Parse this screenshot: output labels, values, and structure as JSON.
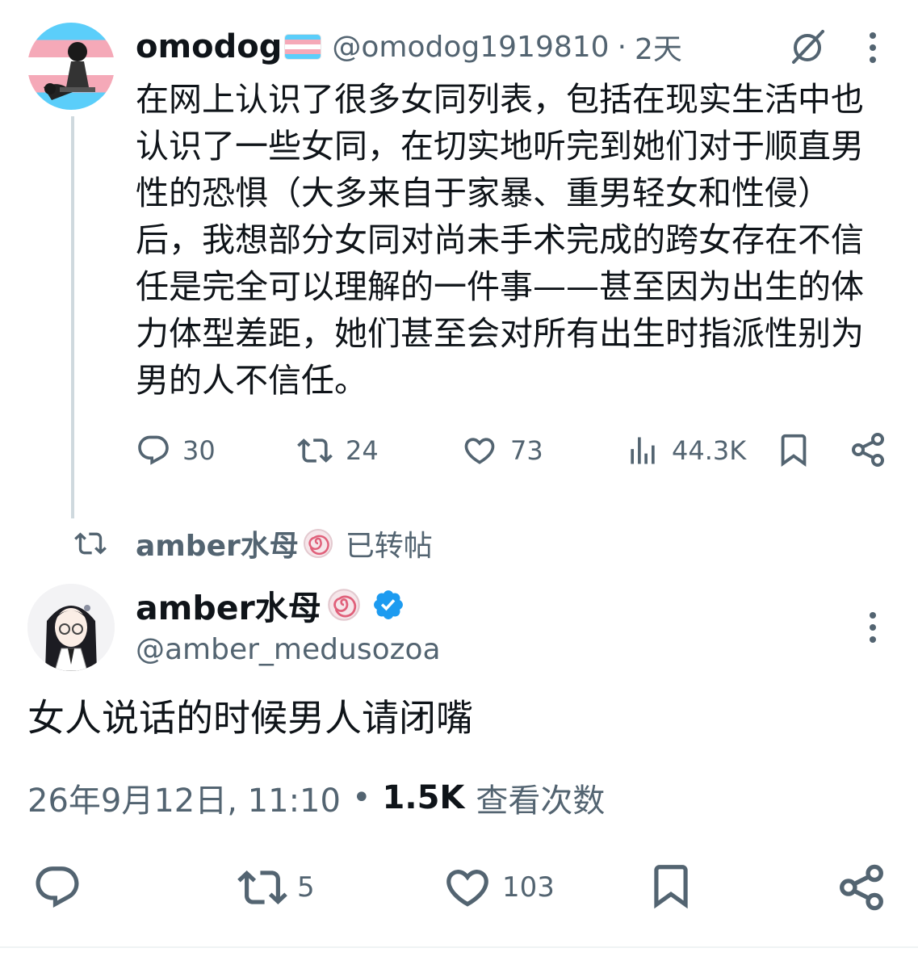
{
  "quoted_tweet": {
    "display_name": "omodog",
    "name_badge": "transgender-flag-emoji",
    "handle": "@omodog1919810",
    "separator": "·",
    "age": "2天",
    "text": "在网上认识了很多女同列表，包括在现实生活中也认识了一些女同，在切实地听完到她们对于顺直男性的恐惧（大多来自于家暴、重男轻女和性侵）后，我想部分女同对尚未手术完成的跨女存在不信任是完全可以理解的一件事——甚至因为出生的体力体型差距，她们甚至会对所有出生时指派性别为男的人不信任。",
    "actions": {
      "replies": "30",
      "reposts": "24",
      "likes": "73",
      "views": "44.3K"
    },
    "icons": [
      "grok-icon",
      "more-icon",
      "reply-icon",
      "repost-icon",
      "like-icon",
      "views-icon",
      "bookmark-icon",
      "share-icon"
    ]
  },
  "repost_label": {
    "user": "amber水母",
    "user_badge": "spiral-emoji",
    "text": "已转帖"
  },
  "main_tweet": {
    "display_name": "amber水母",
    "name_badge": "spiral-emoji",
    "verified": true,
    "handle": "@amber_medusozoa",
    "text": "女人说话的时候男人请闭嘴",
    "timestamp": "26年9月12日, 11:10",
    "separator": "•",
    "views_count": "1.5K",
    "views_label": "查看次数",
    "actions": {
      "reposts": "5",
      "likes": "103"
    }
  },
  "colors": {
    "text_primary": "#0f1419",
    "text_secondary": "#536471",
    "verified_blue": "#1d9bf0",
    "divider": "#cfd9de",
    "trans_blue": "#5bcefa",
    "trans_pink": "#f5a9b8"
  }
}
